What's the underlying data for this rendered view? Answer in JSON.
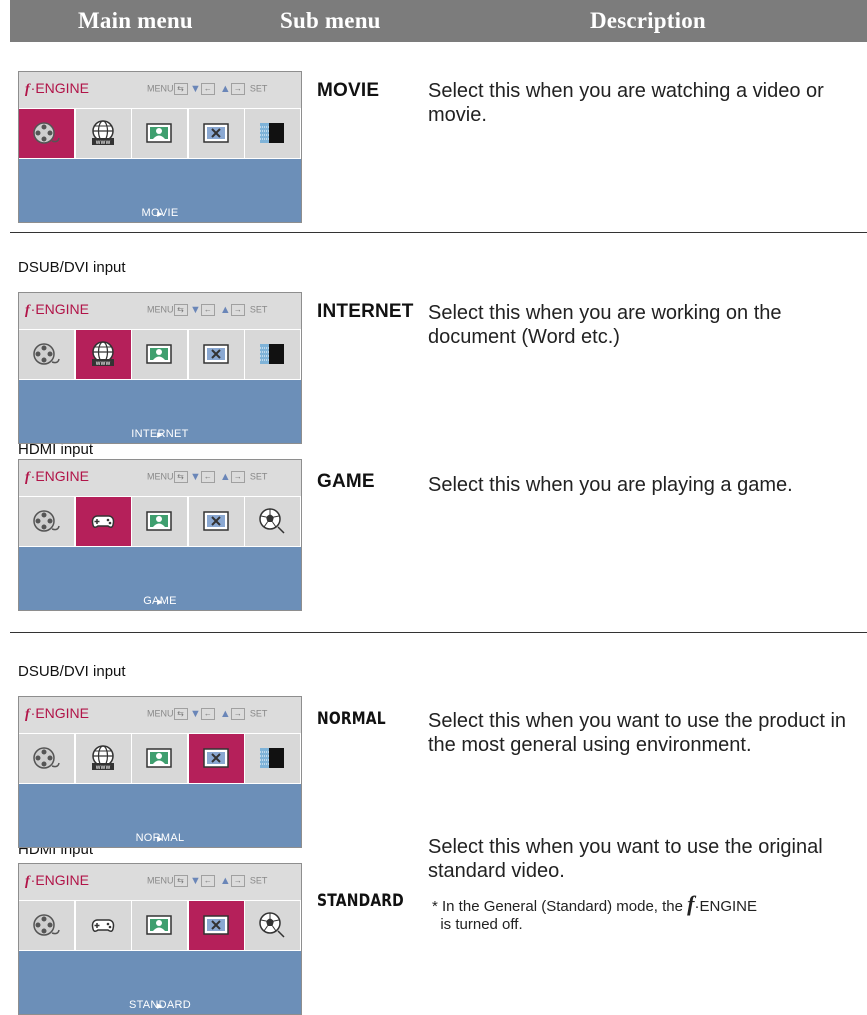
{
  "header": {
    "main_menu": "Main menu",
    "sub_menu": "Sub menu",
    "description": "Description"
  },
  "osd_common": {
    "brand_f": "f",
    "brand_text": "·ENGINE",
    "ctrl_menu": "MENU",
    "ctrl_set": "SET",
    "bar_marker": "▸"
  },
  "sections": [
    {
      "input_label": "",
      "osd_label": "MOVIE",
      "sub": "MOVIE",
      "desc": [
        "Select this when you are watching a video or",
        "movie."
      ],
      "selected": "movie",
      "icons": [
        "movie-icon",
        "internet-icon",
        "photo-icon",
        "normal-icon",
        "standard-icon"
      ]
    },
    {
      "input_label": "DSUB/DVI input",
      "osd_label": "INTERNET",
      "sub": "INTERNET",
      "desc": [
        "Select this when you are working on the",
        "document (Word etc.)"
      ],
      "selected": "internet",
      "icons": [
        "movie-icon",
        "internet-icon",
        "photo-icon",
        "normal-icon",
        "standard-icon"
      ]
    },
    {
      "input_label": "HDMI input",
      "osd_label": "GAME",
      "sub": "GAME",
      "desc": [
        "Select this when you are playing a game."
      ],
      "selected": "game",
      "icons": [
        "movie-icon",
        "game-icon",
        "photo-icon",
        "normal-icon",
        "soccer-icon"
      ]
    },
    {
      "input_label": "DSUB/DVI input",
      "osd_label": "NORMAL",
      "sub": "NORMAL",
      "desc": [
        "Select this when you want to use the product in",
        "the most general using environment."
      ],
      "selected": "normal",
      "icons": [
        "movie-icon",
        "internet-icon",
        "photo-icon",
        "normal-icon",
        "standard-icon"
      ]
    },
    {
      "input_label": "HDMI input",
      "osd_label": "STANDARD",
      "sub": "STANDARD",
      "desc": [
        "Select this when you want to use the original",
        "standard video."
      ],
      "selected": "normal",
      "icons": [
        "movie-icon",
        "game-icon",
        "photo-icon",
        "normal-icon",
        "soccer-icon"
      ]
    }
  ],
  "note": {
    "prefix": "* In the General (Standard) mode, the",
    "suffix": "is turned off."
  },
  "colors": {
    "header_bg": "#7c7c7c",
    "selected_cell": "#b5205a",
    "status_bar": "#6c8fb8",
    "brand": "#b11448"
  }
}
